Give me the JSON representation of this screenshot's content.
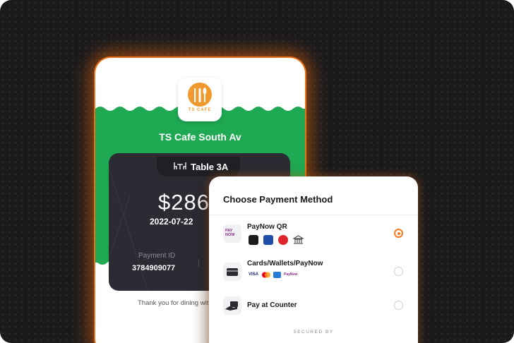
{
  "receipt": {
    "logo_text": "TS CAFE",
    "cafe_name": "TS Cafe South Av",
    "table_label": "Table 3A",
    "amount": "$286",
    "date": "2022-07-22",
    "payment_id_label": "Payment ID",
    "payment_id": "3784909077",
    "thanks_text": "Thank you for dining wit",
    "colors": {
      "green": "#1ea952",
      "card": "#2b2b33",
      "accent": "#f47a1f"
    }
  },
  "payment_sheet": {
    "title": "Choose Payment Method",
    "options": [
      {
        "label": "PayNow QR",
        "icon": "paynow-icon",
        "selected": true,
        "sub_icons": [
          "grabpay-icon",
          "uob-icon",
          "ocbc-icon",
          "bank-icon"
        ]
      },
      {
        "label": "Cards/Wallets/PayNow",
        "icon": "card-icon",
        "selected": false,
        "sub_icons": [
          "visa-icon",
          "mastercard-icon",
          "amex-icon",
          "paynow-mini-icon"
        ]
      },
      {
        "label": "Pay at Counter",
        "icon": "cash-hand-icon",
        "selected": false,
        "sub_icons": []
      }
    ],
    "card_brands": {
      "visa": "VISA",
      "paynow": "PayNow"
    },
    "secured_by": "SECURED BY"
  }
}
